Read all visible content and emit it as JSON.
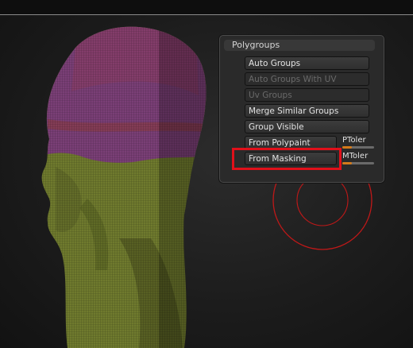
{
  "panel": {
    "title": "Polygroups",
    "buttons": [
      {
        "label": "Auto Groups",
        "enabled": true
      },
      {
        "label": "Auto Groups With UV",
        "enabled": false
      },
      {
        "label": "Uv Groups",
        "enabled": false
      },
      {
        "label": "Merge Similar Groups",
        "enabled": true
      },
      {
        "label": "Group Visible",
        "enabled": true
      },
      {
        "label": "From Polypaint",
        "enabled": true
      },
      {
        "label": "From Masking",
        "enabled": true
      }
    ],
    "sliders": [
      {
        "label": "PToler"
      },
      {
        "label": "MToler"
      }
    ]
  },
  "highlight": {
    "target": "From Masking",
    "color": "#e0101a"
  },
  "colors": {
    "polygroup_purple": "#7a3f76",
    "polygroup_olive": "#6f7a2e",
    "polygroup_red": "#8a3a3a",
    "slider_accent": "#d47a1a",
    "brush_cursor": "#c01818"
  }
}
